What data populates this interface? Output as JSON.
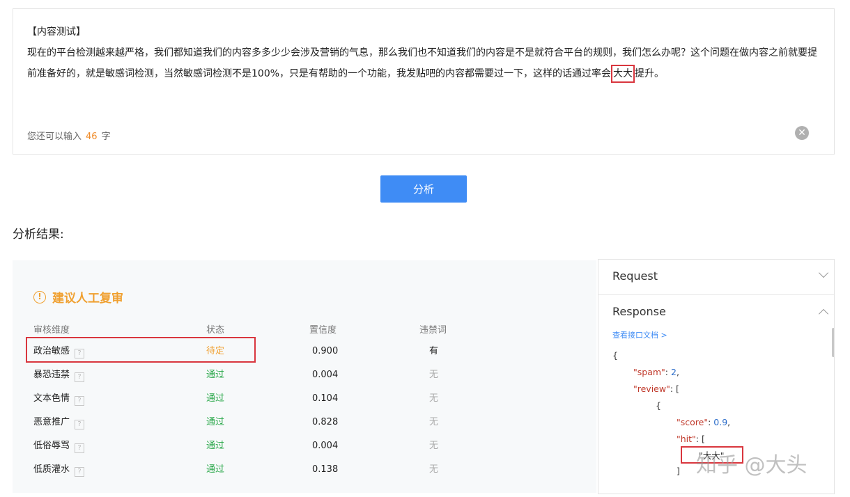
{
  "input": {
    "line1": "【内容测试】",
    "text_before": "现在的平台检测越来越严格，我们都知道我们的内容多多少少会涉及营销的气息，那么我们也不知道我们的内容是不是就符合平台的规则，我们怎么办呢？这个问题在做内容之前就要提前准备好的，就是敏感词检测，当然敏感词检测不是100%，只是有帮助的一个功能，我发贴吧的内容都需要过一下，这样的话通过率会",
    "highlight": "大大",
    "text_after": "提升。",
    "counter_prefix": "您还可以输入",
    "counter_value": "46",
    "counter_suffix": "字",
    "clear_icon": "close-circle-icon"
  },
  "analyze_button": "分析",
  "result_title": "分析结果:",
  "verdict": {
    "icon": "warning-circle-icon",
    "text": "建议人工复审",
    "color": "#f0a030"
  },
  "table": {
    "headers": [
      "审核维度",
      "状态",
      "置信度",
      "违禁词"
    ],
    "rows": [
      {
        "dimension": "政治敏感",
        "status": "待定",
        "confidence": "0.900",
        "banned": "有"
      },
      {
        "dimension": "暴恐违禁",
        "status": "通过",
        "confidence": "0.004",
        "banned": "无"
      },
      {
        "dimension": "文本色情",
        "status": "通过",
        "confidence": "0.104",
        "banned": "无"
      },
      {
        "dimension": "恶意推广",
        "status": "通过",
        "confidence": "0.828",
        "banned": "无"
      },
      {
        "dimension": "低俗辱骂",
        "status": "通过",
        "confidence": "0.004",
        "banned": "无"
      },
      {
        "dimension": "低质灌水",
        "status": "通过",
        "confidence": "0.138",
        "banned": "无"
      }
    ],
    "help_icon": "?"
  },
  "side": {
    "request_label": "Request",
    "response_label": "Response",
    "doc_link": "查看接口文档 >",
    "json": {
      "open": "{",
      "spam_key": "\"spam\"",
      "spam_val": "2",
      "review_key": "\"review\"",
      "review_open": "[",
      "obj_open": "{",
      "score_key": "\"score\"",
      "score_val": "0.9",
      "hit_key": "\"hit\"",
      "hit_open": "[",
      "hit_value": "\"大大\"",
      "close": "]"
    }
  },
  "watermark": "知乎 @大头"
}
